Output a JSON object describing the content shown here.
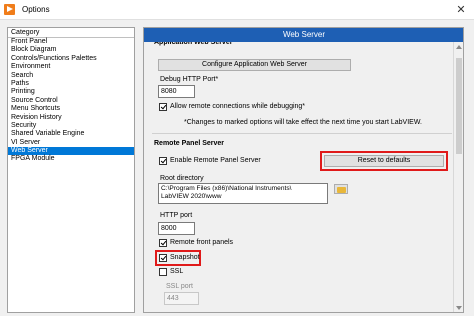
{
  "window": {
    "title": "Options",
    "close_glyph": "✕"
  },
  "category": {
    "header": "Category",
    "items": [
      "Front Panel",
      "Block Diagram",
      "Controls/Functions Palettes",
      "Environment",
      "Search",
      "Paths",
      "Printing",
      "Source Control",
      "Menu Shortcuts",
      "Revision History",
      "Security",
      "Shared Variable Engine",
      "VI Server",
      "Web Server",
      "FPGA Module"
    ],
    "selected": "Web Server"
  },
  "panel": {
    "title": "Web Server",
    "app_server": {
      "label": "Application Web Server",
      "configure_button": "Configure Application Web Server",
      "debug_port_label": "Debug HTTP Port*",
      "debug_port_value": "8080",
      "allow_remote_label": "Allow remote connections while debugging*",
      "allow_remote_checked": true,
      "note": "*Changes to marked options will take effect the next time you start LabVIEW."
    },
    "remote_panel": {
      "label": "Remote Panel Server",
      "enable_label": "Enable Remote Panel Server",
      "enable_checked": true,
      "reset_button": "Reset to defaults",
      "root_dir_label": "Root directory",
      "root_dir_line1": "C:\\Program Files (x86)\\National Instruments\\",
      "root_dir_line2": "LabVIEW 2020\\www",
      "http_port_label": "HTTP port",
      "http_port_value": "8000",
      "remote_front_panels_label": "Remote front panels",
      "remote_front_panels_checked": true,
      "snapshot_label": "Snapshot",
      "snapshot_checked": true,
      "ssl_label": "SSL",
      "ssl_checked": false,
      "ssl_port_label": "SSL port",
      "ssl_port_value": "443"
    }
  },
  "colors": {
    "header_blue": "#1e5fb4",
    "selection_blue": "#0078d7",
    "highlight_red": "#e01a1a"
  },
  "icons": {
    "app": "labview-app-icon",
    "folder": "folder-icon"
  }
}
